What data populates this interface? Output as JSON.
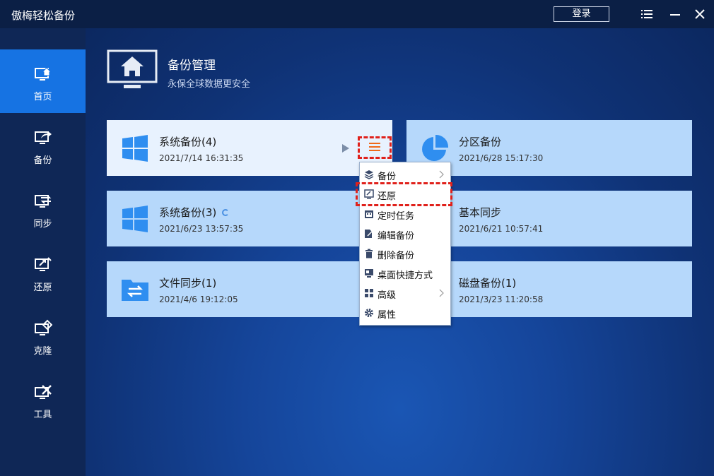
{
  "app": {
    "title": "傲梅轻松备份",
    "login": "登录"
  },
  "sidebar": {
    "items": [
      {
        "label": "首页"
      },
      {
        "label": "备份"
      },
      {
        "label": "同步"
      },
      {
        "label": "还原"
      },
      {
        "label": "克隆"
      },
      {
        "label": "工具"
      }
    ]
  },
  "header": {
    "title": "备份管理",
    "subtitle": "永保全球数据更安全"
  },
  "cards": [
    {
      "name": "系统备份(4)",
      "date": "2021/7/14 16:31:35"
    },
    {
      "name": "分区备份",
      "date": "2021/6/28 15:17:30"
    },
    {
      "name": "系统备份(3)",
      "date": "2021/6/23 13:57:35"
    },
    {
      "name": "基本同步",
      "date": "2021/6/21 10:57:41"
    },
    {
      "name": "文件同步(1)",
      "date": "2021/4/6 19:12:05"
    },
    {
      "name": "磁盘备份(1)",
      "date": "2021/3/23 11:20:58"
    }
  ],
  "menu": [
    {
      "label": "备份"
    },
    {
      "label": "还原"
    },
    {
      "label": "定时任务"
    },
    {
      "label": "编辑备份"
    },
    {
      "label": "删除备份"
    },
    {
      "label": "桌面快捷方式"
    },
    {
      "label": "高级"
    },
    {
      "label": "属性"
    }
  ],
  "colors": {
    "accent": "#1673e3",
    "card": "#b6d8fb",
    "card_selected": "#e8f2fe",
    "highlight": "#e0211b",
    "hamburger": "#f06a1c"
  }
}
